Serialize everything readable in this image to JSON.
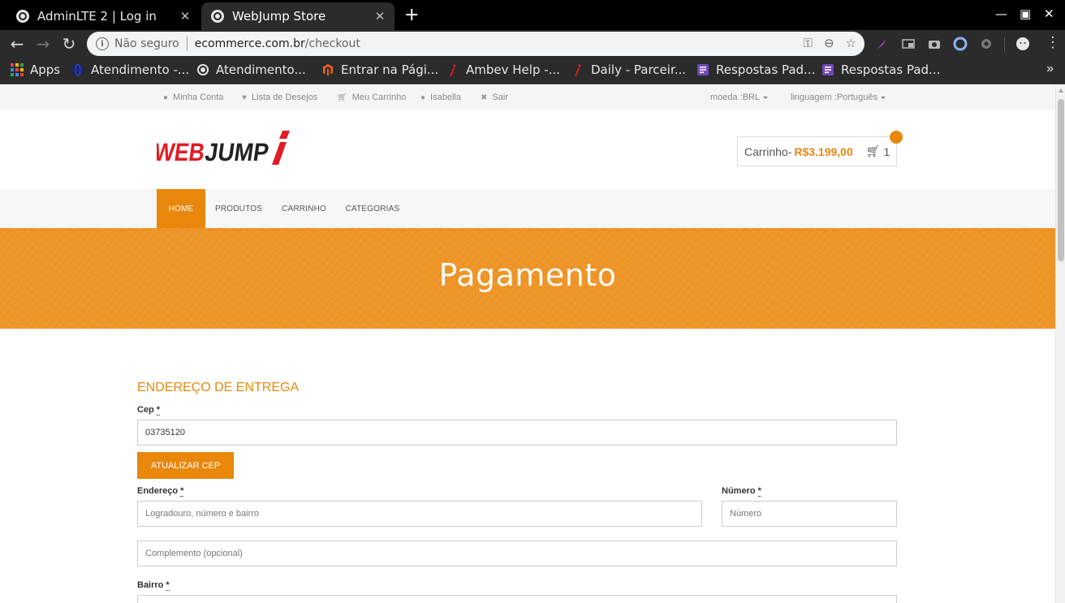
{
  "browser": {
    "tabs": [
      {
        "title": "AdminLTE 2 | Log in",
        "active": false
      },
      {
        "title": "WebJump Store",
        "active": true
      }
    ],
    "url": {
      "security_label": "Não seguro",
      "domain": "ecommerce.com.br",
      "path": "/checkout"
    },
    "bookmarks": [
      {
        "label": "Apps",
        "icon": "apps-grid-icon"
      },
      {
        "label": "Atendimento -...",
        "icon": "globe-blue-icon"
      },
      {
        "label": "Atendimento...",
        "icon": "globe-icon"
      },
      {
        "label": "Entrar na Pági...",
        "icon": "magento-icon"
      },
      {
        "label": "Ambev Help -...",
        "icon": "webjump-i-icon"
      },
      {
        "label": "Daily - Parceir...",
        "icon": "webjump-i-icon"
      },
      {
        "label": "Respostas Pad...",
        "icon": "forms-icon"
      },
      {
        "label": "Respostas Pad...",
        "icon": "forms-icon"
      }
    ]
  },
  "store": {
    "topbar": {
      "links": [
        "Minha Conta",
        "Lista de Desejos",
        "Meu Carrinho",
        "Isabella",
        "Sair"
      ],
      "currency": "moeda :BRL",
      "language": "linguagem :Português"
    },
    "logo_text": "WEBJUMP",
    "cart": {
      "label": "Carrinho-",
      "price": "R$3.199,00",
      "count": "1"
    },
    "nav": [
      "HOME",
      "PRODUTOS",
      "CARRINHO",
      "CATEGORIAS"
    ],
    "banner_title": "Pagamento",
    "form": {
      "section_title": "ENDEREÇO DE ENTREGA",
      "cep_label": "Cep",
      "cep_value": "03735120",
      "update_button": "ATUALIZAR CEP",
      "address_label": "Endereço",
      "address_placeholder": "Logradouro, número e bairro",
      "number_label": "Número",
      "number_placeholder": "Número",
      "complement_placeholder": "Complemento (opcional)",
      "district_label": "Bairro",
      "required_mark": "*"
    }
  },
  "colors": {
    "accent": "#e8870b",
    "banner": "#ee9527"
  }
}
